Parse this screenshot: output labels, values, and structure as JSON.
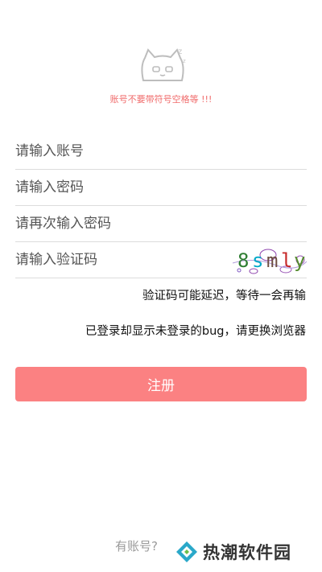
{
  "header": {
    "logo": "sleeping-cat-logo",
    "tip": "账号不要带符号空格等 !!!"
  },
  "form": {
    "account_placeholder": "请输入账号",
    "password_placeholder": "请输入密码",
    "confirm_placeholder": "请再次输入密码",
    "captcha_placeholder": "请输入验证码",
    "captcha": {
      "chars": [
        "8",
        "s",
        "m",
        "l",
        "y"
      ],
      "colors": [
        "#2e7d32",
        "#00a8c8",
        "#6d4c41",
        "#c62828",
        "#558b2f"
      ]
    }
  },
  "notes": {
    "captcha_delay": "验证码可能延迟，等待一会再输",
    "login_bug": "已登录却显示未登录的bug，请更换浏览器"
  },
  "register_button": "注册",
  "footer": {
    "has_account": "有账号?",
    "watermark": "热潮软件园"
  },
  "colors": {
    "accent": "#fb8182",
    "tip": "#f06b6b"
  }
}
